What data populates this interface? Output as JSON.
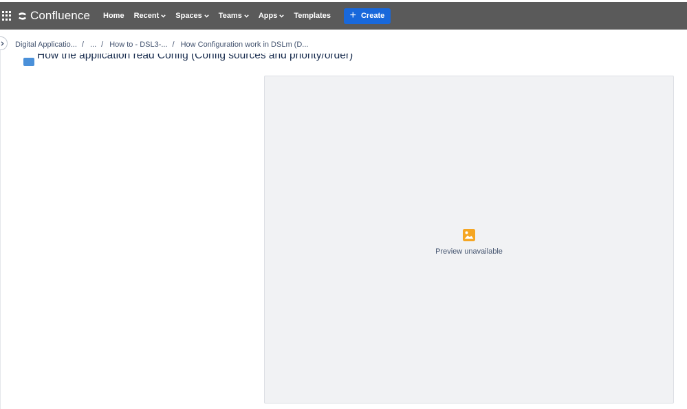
{
  "topbar": {
    "logo_text": "Confluence",
    "nav": [
      {
        "label": "Home",
        "has_dropdown": false
      },
      {
        "label": "Recent",
        "has_dropdown": true
      },
      {
        "label": "Spaces",
        "has_dropdown": true
      },
      {
        "label": "Teams",
        "has_dropdown": true
      },
      {
        "label": "Apps",
        "has_dropdown": true
      },
      {
        "label": "Templates",
        "has_dropdown": false
      }
    ],
    "create_label": "Create",
    "background_color": "#5a5a5a",
    "create_color": "#1868db"
  },
  "breadcrumb": {
    "items": [
      "Digital Applicatio...",
      "...",
      "How to - DSL3-...",
      "How Configuration work in DSLm (D..."
    ],
    "separator": "/"
  },
  "page": {
    "title": "How the application read Config (Config sources and priority/order)"
  },
  "preview": {
    "message": "Preview unavailable",
    "icon": "image-icon",
    "icon_color": "#f5a623"
  }
}
